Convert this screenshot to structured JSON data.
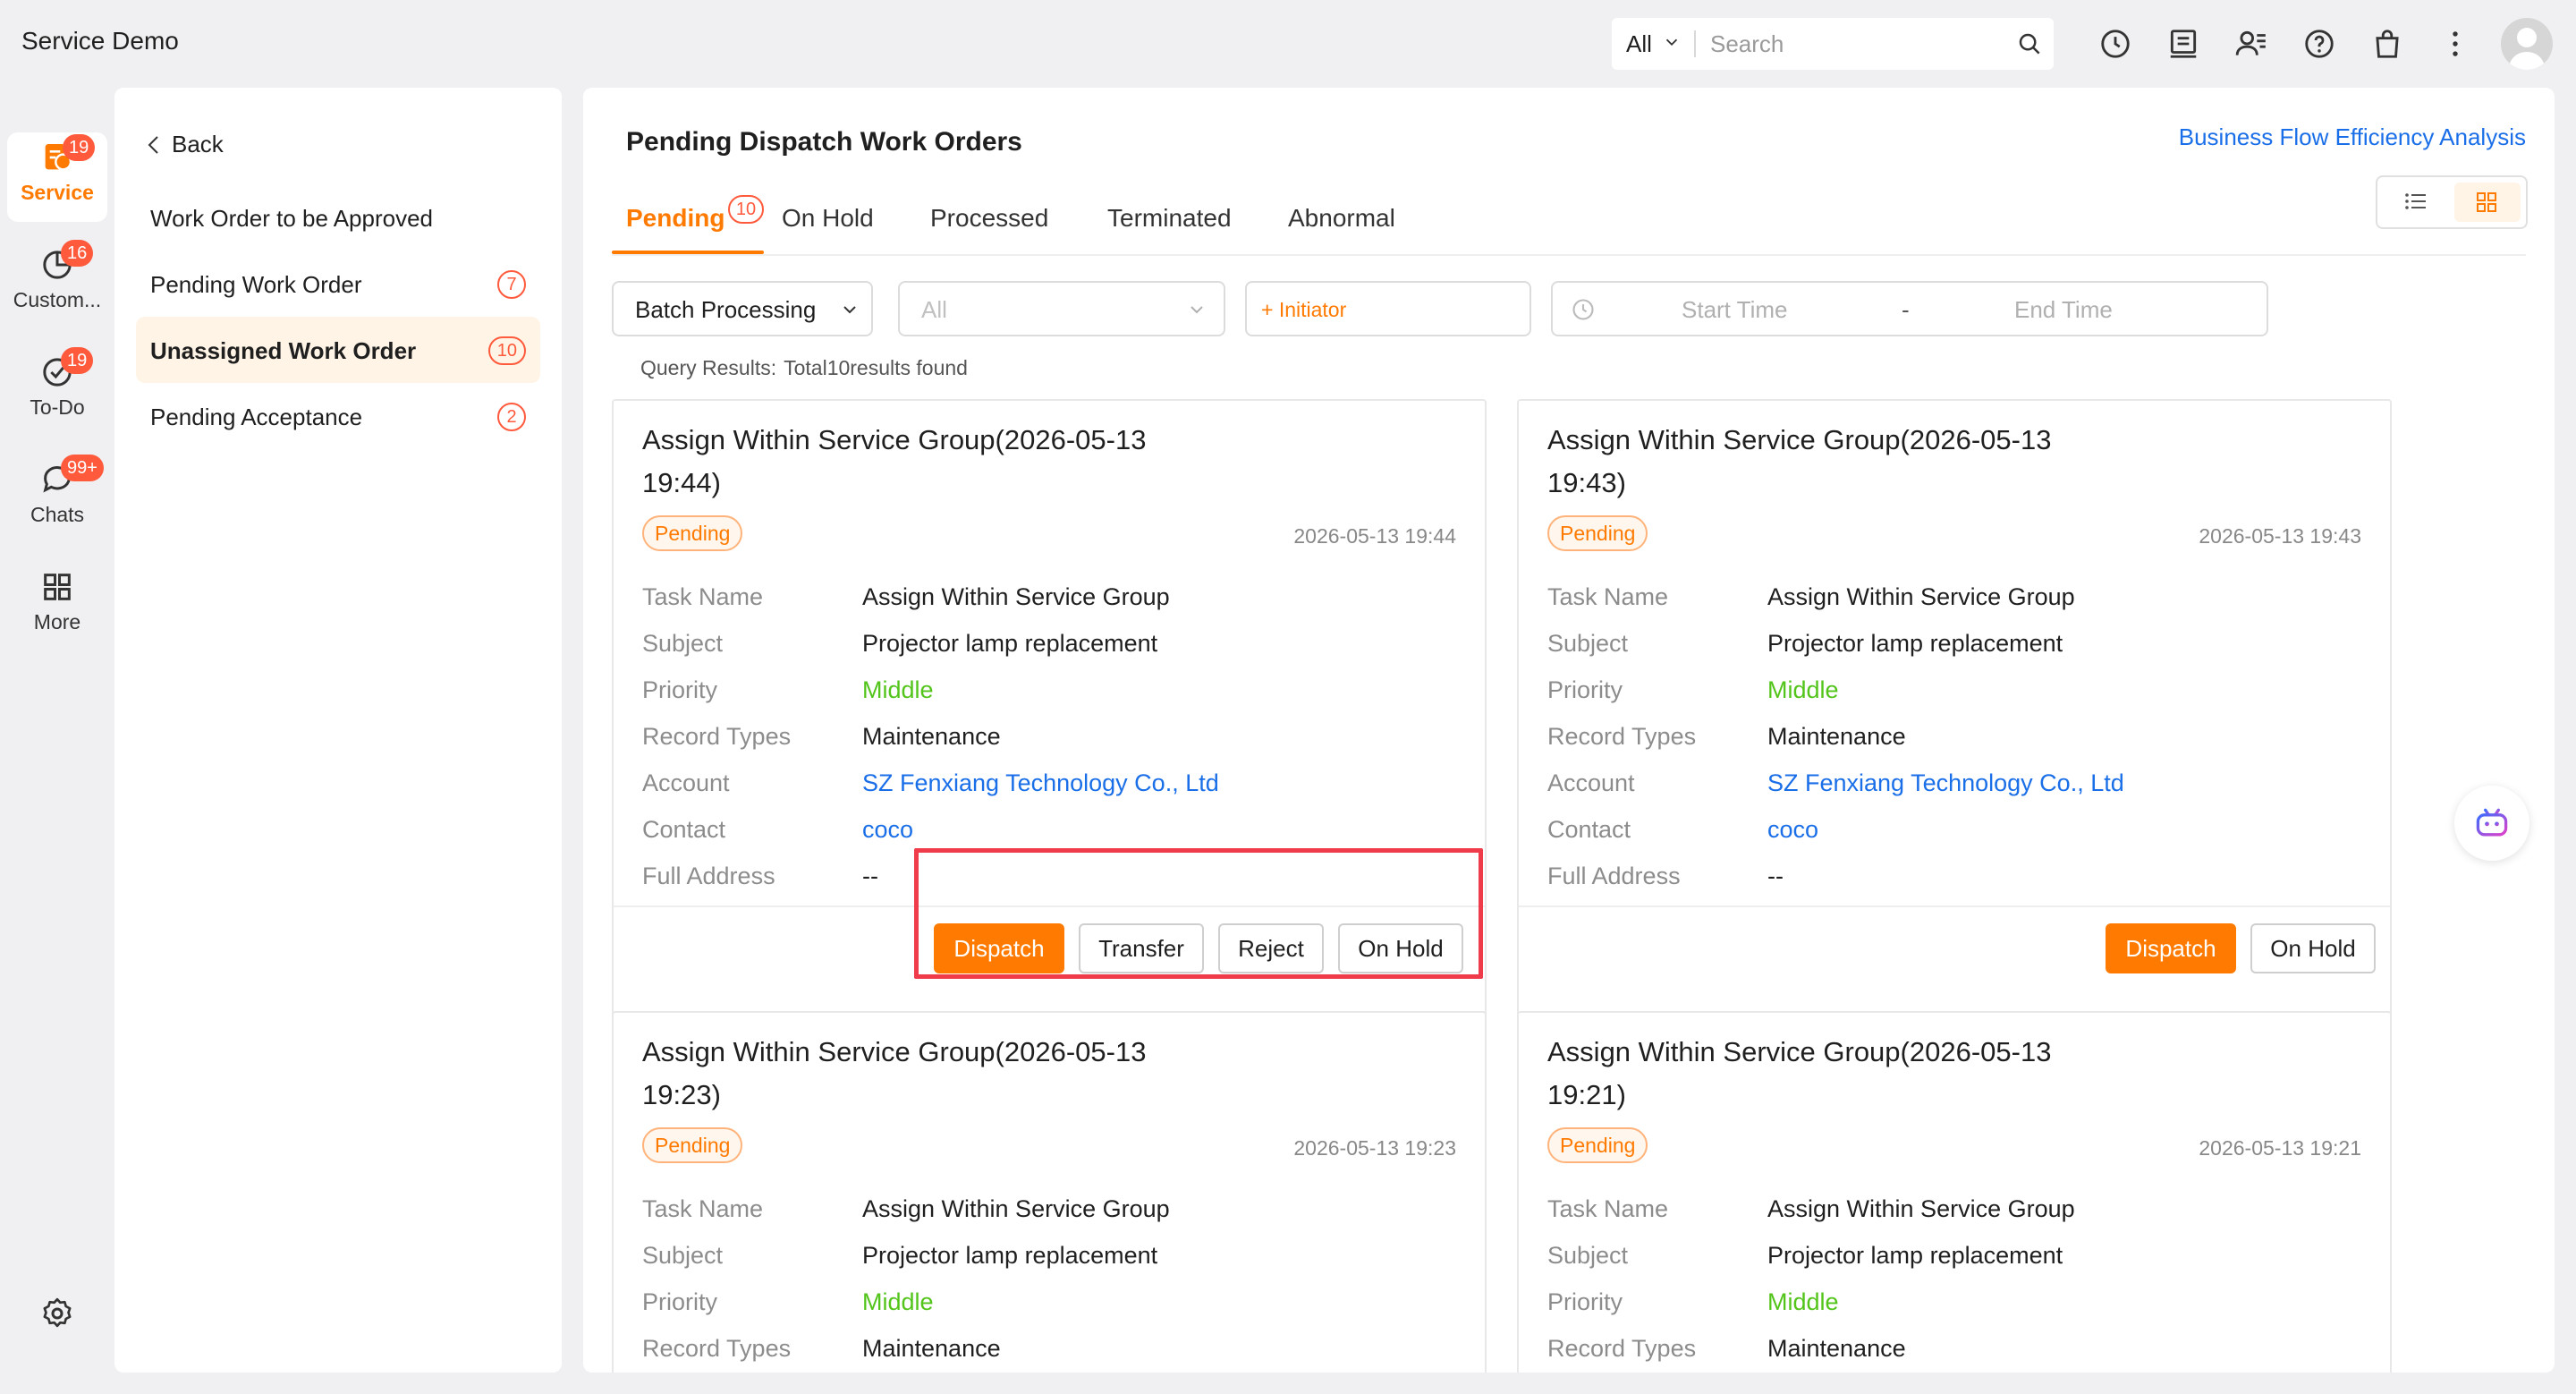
{
  "app": {
    "title": "Service Demo"
  },
  "search": {
    "scope": "All",
    "placeholder": "Search"
  },
  "rail": [
    {
      "label": "Service",
      "badge": "19",
      "active": true
    },
    {
      "label": "Custom...",
      "badge": "16"
    },
    {
      "label": "To-Do",
      "badge": "19"
    },
    {
      "label": "Chats",
      "badge": "99+"
    },
    {
      "label": "More"
    }
  ],
  "sidebar": {
    "back_label": "Back",
    "items": [
      {
        "label": "Work Order to be Approved"
      },
      {
        "label": "Pending Work Order",
        "count": "7"
      },
      {
        "label": "Unassigned Work Order",
        "count": "10",
        "active": true
      },
      {
        "label": "Pending Acceptance",
        "count": "2"
      }
    ]
  },
  "main": {
    "title": "Pending Dispatch Work Orders",
    "top_link": "Business Flow Efficiency Analysis",
    "tabs": [
      {
        "label": "Pending",
        "badge": "10",
        "active": true
      },
      {
        "label": "On Hold"
      },
      {
        "label": "Processed"
      },
      {
        "label": "Terminated"
      },
      {
        "label": "Abnormal"
      }
    ],
    "filters": {
      "batch": "Batch Processing",
      "status_placeholder": "All",
      "initiator": "+ Initiator",
      "start_time": "Start Time",
      "range_sep": "-",
      "end_time": "End Time"
    },
    "query": {
      "label": "Query Results:",
      "value": "Total10results found"
    }
  },
  "field_labels": {
    "task_name": "Task Name",
    "subject": "Subject",
    "priority": "Priority",
    "record_types": "Record Types",
    "account": "Account",
    "contact": "Contact",
    "full_address": "Full Address"
  },
  "cards": [
    {
      "title": "Assign Within Service Group(2026-05-13 19:44)",
      "status": "Pending",
      "time": "2026-05-13 19:44",
      "task_name": "Assign Within Service Group",
      "subject": "Projector lamp replacement",
      "priority": "Middle",
      "record_types": "Maintenance",
      "account": "SZ Fenxiang Technology Co., Ltd",
      "contact": "coco",
      "full_address": "--",
      "buttons": [
        "Dispatch",
        "Transfer",
        "Reject",
        "On Hold"
      ]
    },
    {
      "title": "Assign Within Service Group(2026-05-13 19:43)",
      "status": "Pending",
      "time": "2026-05-13 19:43",
      "task_name": "Assign Within Service Group",
      "subject": "Projector lamp replacement",
      "priority": "Middle",
      "record_types": "Maintenance",
      "account": "SZ Fenxiang Technology Co., Ltd",
      "contact": "coco",
      "full_address": "--",
      "buttons": [
        "Dispatch",
        "On Hold"
      ]
    },
    {
      "title": "Assign Within Service Group(2026-05-13 19:23)",
      "status": "Pending",
      "time": "2026-05-13 19:23",
      "task_name": "Assign Within Service Group",
      "subject": "Projector lamp replacement",
      "priority": "Middle",
      "record_types": "Maintenance"
    },
    {
      "title": "Assign Within Service Group(2026-05-13 19:21)",
      "status": "Pending",
      "time": "2026-05-13 19:21",
      "task_name": "Assign Within Service Group",
      "subject": "Projector lamp replacement",
      "priority": "Middle",
      "record_types": "Maintenance"
    }
  ],
  "colors": {
    "accent": "#ff7a00",
    "badge": "#ff5a3c",
    "link": "#1a6fe8",
    "priority_middle": "#52c41a",
    "highlight": "#ef3b4a"
  }
}
